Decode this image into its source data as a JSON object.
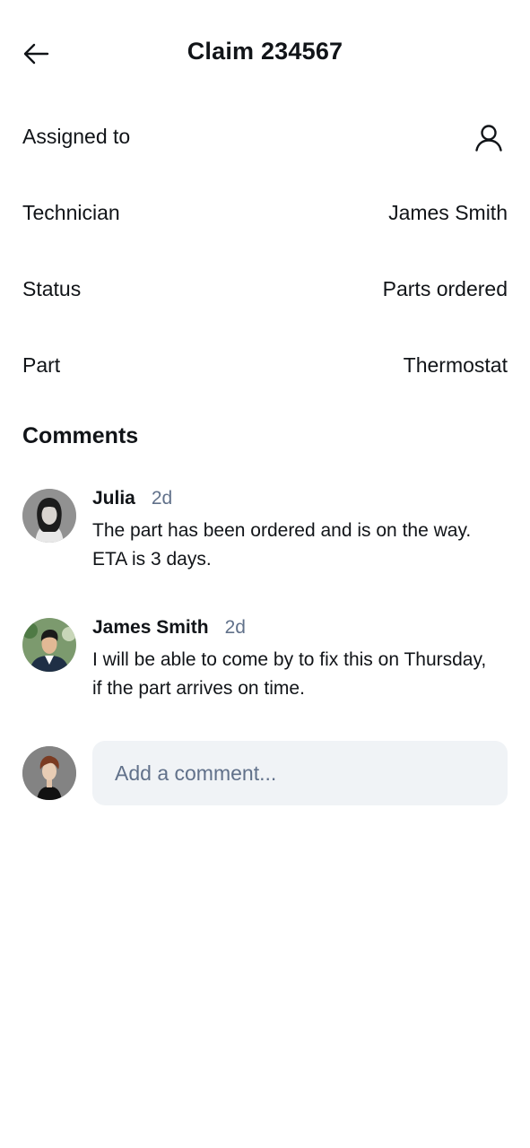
{
  "header": {
    "title": "Claim 234567",
    "back_icon": "arrow-left-icon"
  },
  "details": [
    {
      "label": "Assigned to",
      "icon": "user-icon"
    },
    {
      "label": "Technician",
      "value": "James Smith"
    },
    {
      "label": "Status",
      "value": "Parts ordered"
    },
    {
      "label": "Part",
      "value": "Thermostat"
    }
  ],
  "comments": {
    "title": "Comments",
    "items": [
      {
        "author": "Julia",
        "time": "2d",
        "text_line1": "The part has been ordered and is on the way.",
        "text_line2": "ETA is 3 days."
      },
      {
        "author": "James Smith",
        "time": "2d",
        "text_line1": "I will be able to come by to fix this on Thursday,",
        "text_line2": "if the part arrives on time."
      }
    ],
    "composer": {
      "placeholder": "Add a comment..."
    }
  },
  "colors": {
    "text": "#111418",
    "muted": "#61718a",
    "input_bg": "#f0f3f6"
  }
}
